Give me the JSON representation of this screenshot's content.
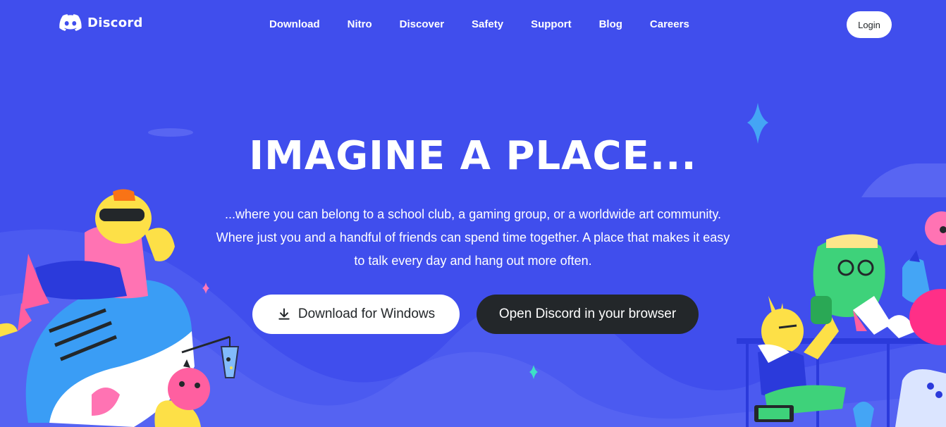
{
  "brand": {
    "name": "Discord",
    "icon": "discord-logo-icon"
  },
  "nav": {
    "items": [
      {
        "label": "Download"
      },
      {
        "label": "Nitro"
      },
      {
        "label": "Discover"
      },
      {
        "label": "Safety"
      },
      {
        "label": "Support"
      },
      {
        "label": "Blog"
      },
      {
        "label": "Careers"
      }
    ],
    "login_label": "Login"
  },
  "hero": {
    "title": "IMAGINE A PLACE...",
    "body_lines": [
      "...where you can belong to a school club, a gaming group, or a worldwide art community.",
      "Where just you and a handful of friends can spend time together. A place that makes it easy",
      "to talk every day and hang out more often."
    ],
    "download_label": "Download for Windows",
    "download_icon": "download-icon",
    "browser_label": "Open Discord in your browser"
  },
  "colors": {
    "background": "#404eed",
    "button_light": "#ffffff",
    "button_dark": "#23272a",
    "text_dark": "#23272a"
  }
}
